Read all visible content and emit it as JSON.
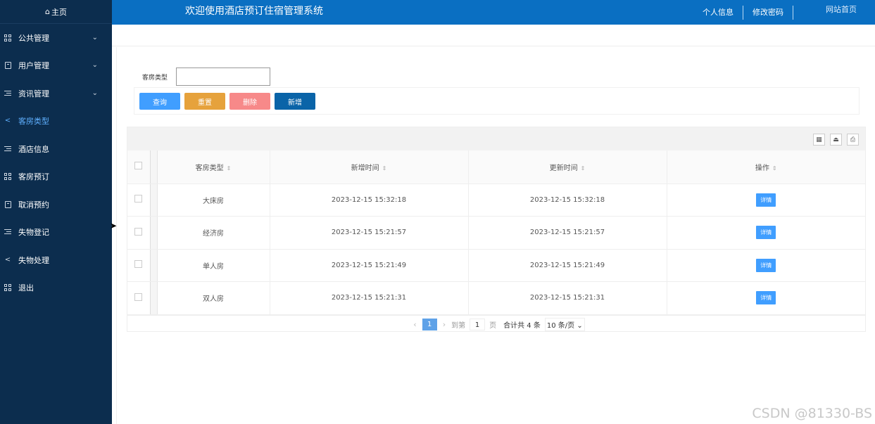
{
  "sidebar": {
    "home_icon": "home-icon",
    "home_label": "主页",
    "items": [
      {
        "label": "公共管理",
        "icon": "grid-icon",
        "expandable": true
      },
      {
        "label": "用户管理",
        "icon": "book-icon",
        "expandable": true
      },
      {
        "label": "资讯管理",
        "icon": "list-icon",
        "expandable": true
      },
      {
        "label": "客房类型",
        "icon": "share-icon",
        "active": true
      },
      {
        "label": "酒店信息",
        "icon": "list-icon"
      },
      {
        "label": "客房预订",
        "icon": "grid-icon"
      },
      {
        "label": "取消预约",
        "icon": "book-icon"
      },
      {
        "label": "失物登记",
        "icon": "list-icon"
      },
      {
        "label": "失物处理",
        "icon": "share-icon"
      },
      {
        "label": "退出",
        "icon": "grid-icon"
      }
    ]
  },
  "header": {
    "title": "欢迎使用酒店预订住宿管理系统",
    "links": [
      "个人信息",
      "修改密码",
      "网站首页"
    ]
  },
  "search": {
    "label": "客房类型",
    "value": "",
    "placeholder": ""
  },
  "buttons": {
    "query": "查询",
    "reset": "重置",
    "delete": "删除",
    "add": "新增"
  },
  "table": {
    "columns": [
      "客房类型",
      "新增时间",
      "更新时间",
      "操作"
    ],
    "rows": [
      {
        "type": "大床房",
        "created": "2023-12-15 15:32:18",
        "updated": "2023-12-15 15:32:18",
        "action": "详情"
      },
      {
        "type": "经济房",
        "created": "2023-12-15 15:21:57",
        "updated": "2023-12-15 15:21:57",
        "action": "详情"
      },
      {
        "type": "单人房",
        "created": "2023-12-15 15:21:49",
        "updated": "2023-12-15 15:21:49",
        "action": "详情"
      },
      {
        "type": "双人房",
        "created": "2023-12-15 15:21:31",
        "updated": "2023-12-15 15:21:31",
        "action": "详情"
      }
    ]
  },
  "pager": {
    "current": "1",
    "goto_label": "到第",
    "goto_value": "1",
    "page_unit": "页",
    "total": "合计共 4 条",
    "page_size": "10 条/页"
  },
  "watermark": "CSDN @81330-BS",
  "colors": {
    "sidebar_bg": "#0c2d4e",
    "header_bg": "#0a6fc2",
    "query": "#409eff",
    "reset": "#e6a23c",
    "delete": "#f78989",
    "add": "#0a64a8"
  }
}
